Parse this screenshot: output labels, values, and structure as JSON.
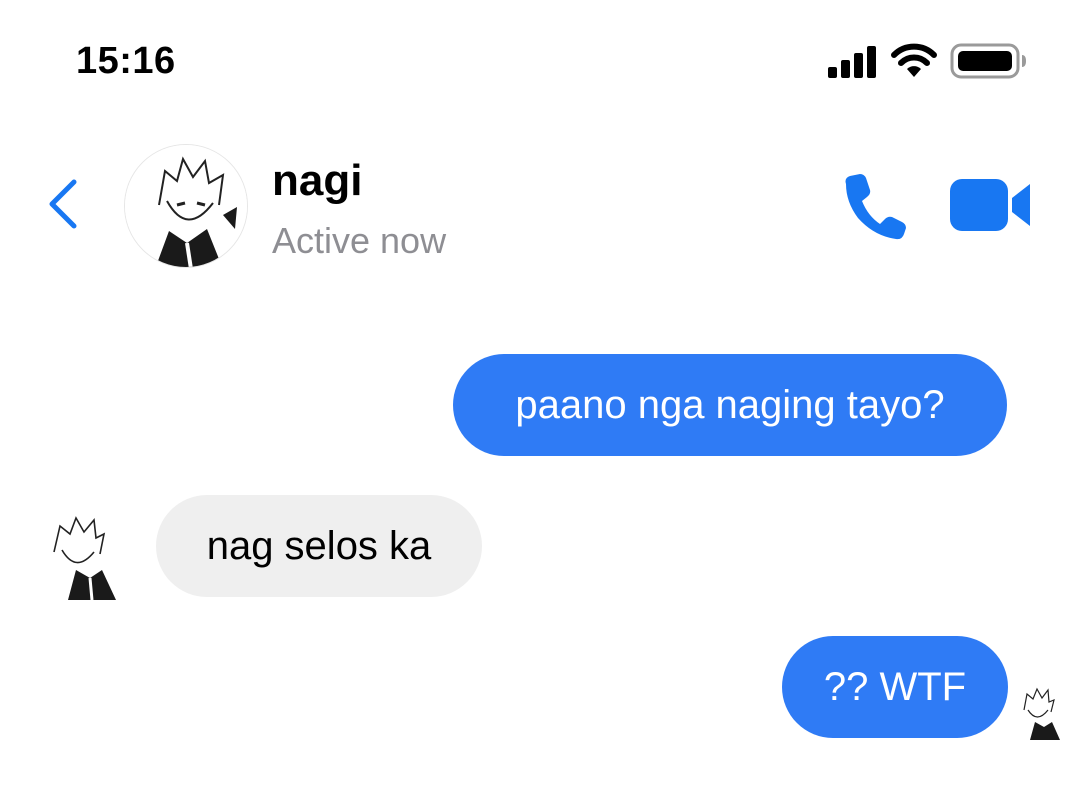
{
  "status_bar": {
    "time": "15:16",
    "signal_icon": "cellular-signal-icon",
    "wifi_icon": "wifi-icon",
    "battery_icon": "battery-icon"
  },
  "header": {
    "back_icon": "chevron-left-icon",
    "contact_name": "nagi",
    "contact_status": "Active now",
    "call_icon": "phone-icon",
    "video_icon": "video-camera-icon",
    "accent_color": "#1877f2"
  },
  "messages": [
    {
      "direction": "outgoing",
      "text": "paano nga naging tayo?"
    },
    {
      "direction": "incoming",
      "text": "nag selos ka"
    },
    {
      "direction": "outgoing",
      "text": "?? WTF"
    }
  ],
  "colors": {
    "outgoing_bubble": "#2f7bf5",
    "incoming_bubble": "#efefef",
    "status_text": "#8e8e93"
  }
}
